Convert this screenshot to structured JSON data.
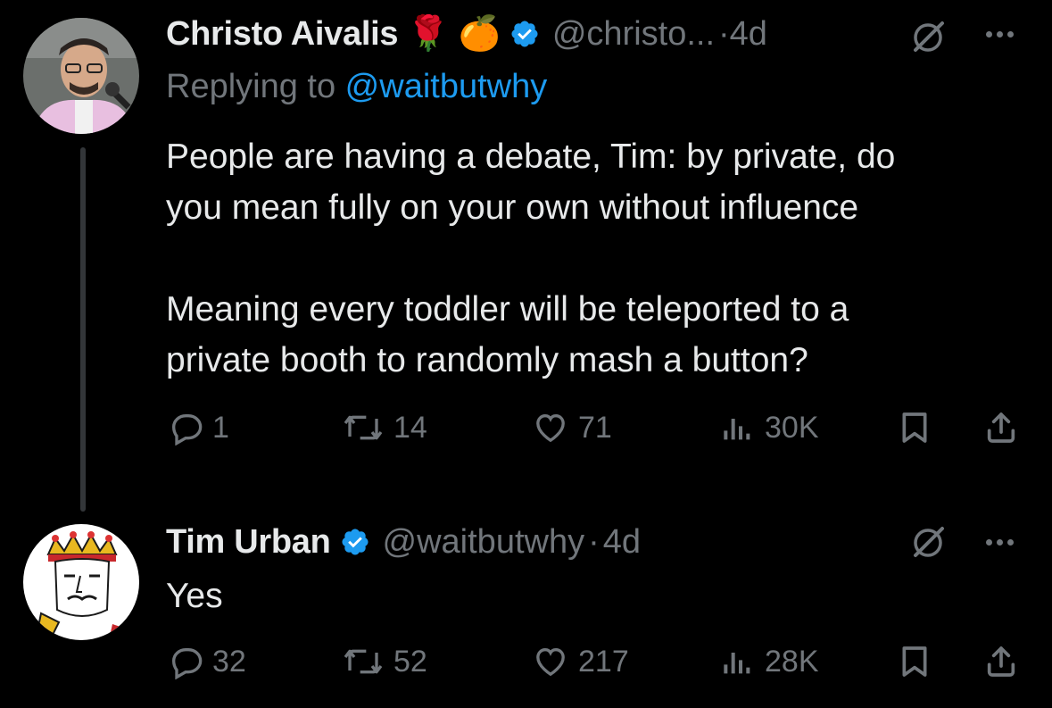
{
  "tweet1": {
    "name": "Christo Aivalis",
    "name_emojis": [
      "🌹",
      "🍊"
    ],
    "handle": "@christo...",
    "dot": "·",
    "time": "4d",
    "replying_prefix": "Replying to ",
    "replying_handle": "@waitbutwhy",
    "text_p1_l1": "People are having a debate, Tim: by private, do",
    "text_p1_l2": "you mean fully on your own without influence",
    "text_p2_l1": "Meaning every toddler will be teleported to a",
    "text_p2_l2": "private booth to randomly mash a button?",
    "replies": "1",
    "reposts": "14",
    "likes": "71",
    "views": "30K"
  },
  "tweet2": {
    "name": "Tim Urban",
    "handle": "@waitbutwhy",
    "dot": "·",
    "time": "4d",
    "text": "Yes",
    "replies": "32",
    "reposts": "52",
    "likes": "217",
    "views": "28K"
  },
  "icons": {
    "verified": "verified-badge-icon",
    "grok": "grok-icon",
    "more": "more-icon",
    "reply": "reply-icon",
    "repost": "repost-icon",
    "like": "heart-icon",
    "views": "views-icon",
    "bookmark": "bookmark-icon",
    "share": "share-icon"
  },
  "colors": {
    "background": "#000000",
    "text": "#e7e9ea",
    "muted": "#71767b",
    "accent": "#1d9bf0"
  }
}
